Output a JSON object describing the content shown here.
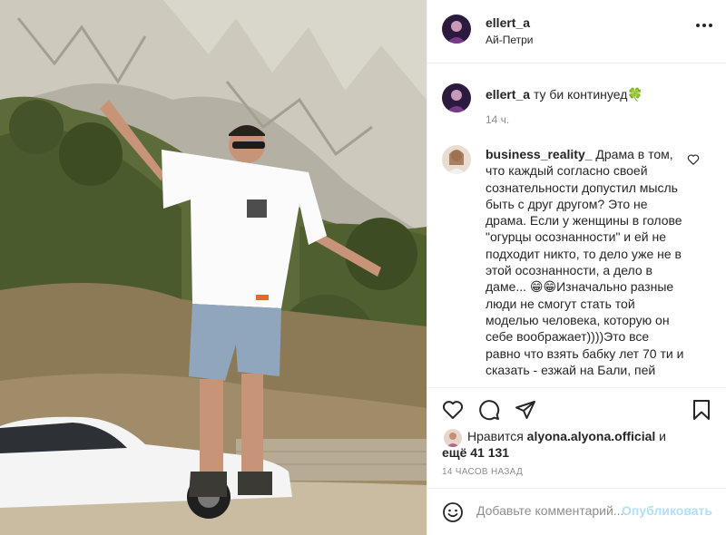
{
  "header": {
    "username": "ellert_a",
    "location": "Ай-Петри"
  },
  "caption": {
    "username": "ellert_a",
    "text": "ту би континуед🍀",
    "time": "14 ч."
  },
  "comment": {
    "username": "business_reality_",
    "text": "Драма в том, что каждый согласно своей сознательности допустил мысль быть с друг другом? Это не драма. Если у женщины в голове \"огурцы осознанности\" и ей не подходит никто, то дело уже не в этой осознанности, а дело в даме... 😁😁Изначально разные люди не смогут стать той моделью человека, которую он себе воображает))))Это все равно что взять бабку лет 70 ти и сказать - езжай на Бали, пей"
  },
  "likes": {
    "prefix": "Нравится",
    "user": "alyona.alyona.official",
    "conj": "и",
    "more": "ещё 41 131"
  },
  "timestamp": "14 ЧАСОВ НАЗАД",
  "add_comment": {
    "placeholder": "Добавьте комментарий...",
    "publish": "Опубликовать"
  },
  "icons": {
    "like": "heart-icon",
    "comment": "comment-icon",
    "share": "paper-plane-icon",
    "save": "bookmark-icon",
    "more": "more-dots-icon",
    "emoji": "smiley-icon"
  },
  "colors": {
    "text": "#262626",
    "secondary": "#8e8e8e",
    "border": "#efefef",
    "publish_disabled": "#b2dffc"
  }
}
